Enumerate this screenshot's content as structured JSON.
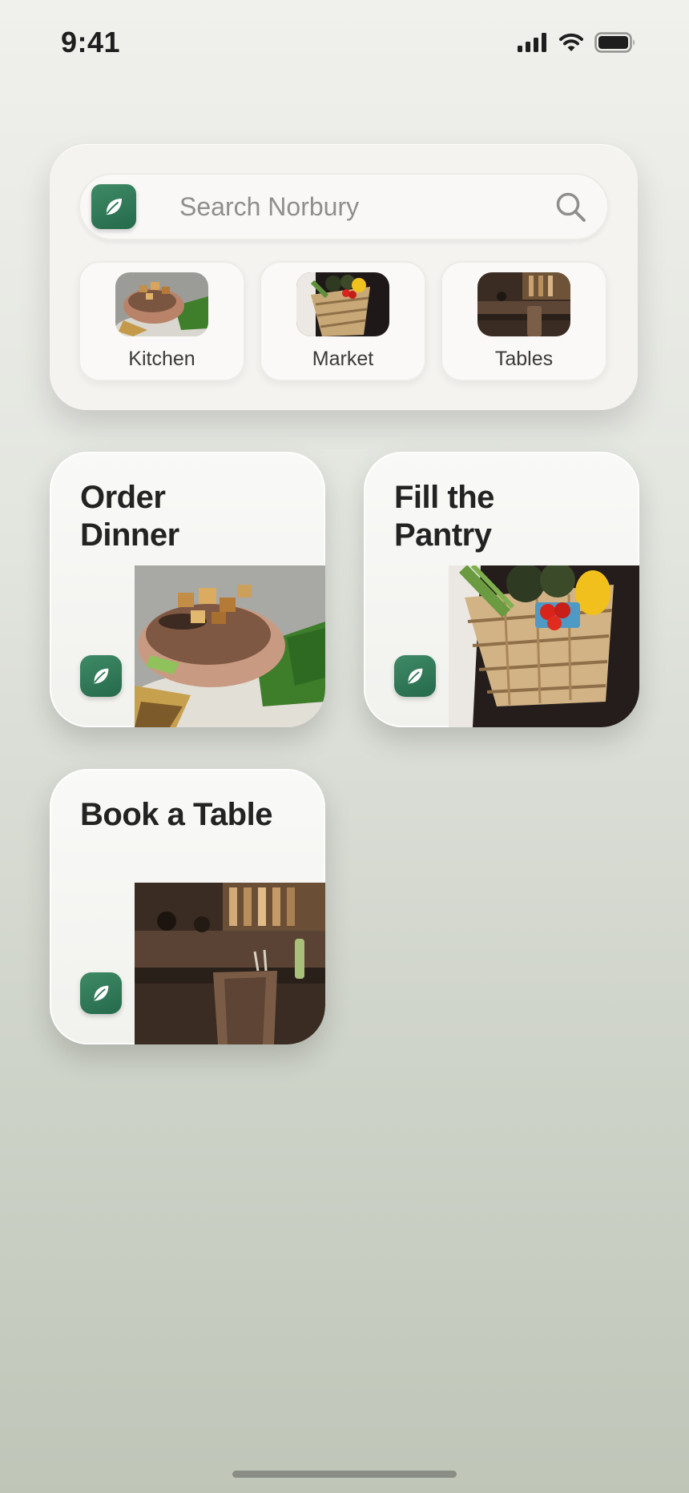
{
  "status_bar": {
    "time": "9:41"
  },
  "search": {
    "placeholder": "Search Norbury"
  },
  "quick_links": [
    {
      "label": "Kitchen"
    },
    {
      "label": "Market"
    },
    {
      "label": "Tables"
    }
  ],
  "cards": [
    {
      "title": "Order Dinner"
    },
    {
      "title": "Fill the Pantry"
    },
    {
      "title": "Book a Table"
    }
  ],
  "colors": {
    "accent": "#2f7655",
    "panel": "#f4f3f0"
  },
  "icons": [
    "leaf-icon",
    "search-icon",
    "signal-icon",
    "wifi-icon",
    "battery-icon"
  ]
}
